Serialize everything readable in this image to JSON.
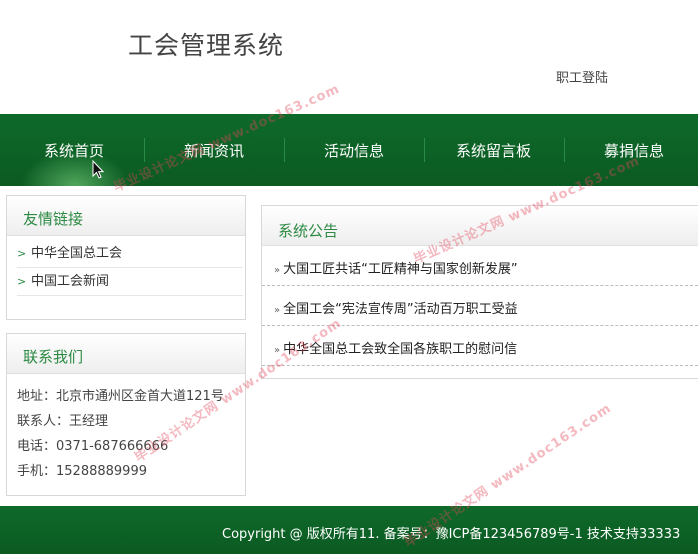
{
  "header": {
    "title": "工会管理系统",
    "login_link": "职工登陆"
  },
  "nav": {
    "items": [
      {
        "label": "系统首页"
      },
      {
        "label": "新闻资讯"
      },
      {
        "label": "活动信息"
      },
      {
        "label": "系统留言板"
      },
      {
        "label": "募捐信息"
      }
    ]
  },
  "sidebar": {
    "friend_links": {
      "title": "友情链接",
      "items": [
        "中华全国总工会",
        "中国工会新闻"
      ]
    },
    "contact": {
      "title": "联系我们",
      "address": "地址：北京市通州区金首大道121号",
      "person": "联系人：王经理",
      "phone": "电话：0371-687666666",
      "mobile": "手机：15288889999"
    }
  },
  "notice": {
    "title": "系统公告",
    "items": [
      "大国工匠共话“工匠精神与国家创新发展”",
      "全国工会“宪法宣传周”活动百万职工受益",
      "中华全国总工会致全国各族职工的慰问信"
    ]
  },
  "footer": {
    "text": "Copyright @ 版权所有11. 备案号：豫ICP备123456789号-1   技术支持33333"
  },
  "watermark": {
    "text": "毕业设计论文网 www.doc163.com",
    "color": "#e1465a"
  }
}
